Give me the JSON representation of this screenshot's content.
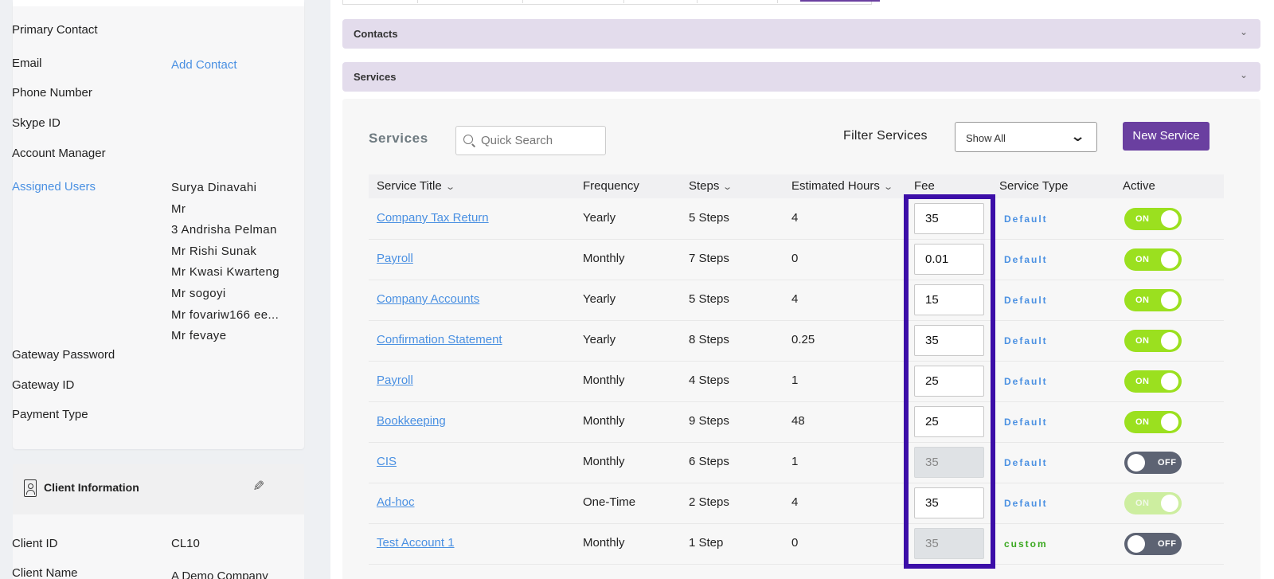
{
  "left_panel": {
    "fields": [
      {
        "label": "Primary Contact",
        "value": ""
      },
      {
        "label": "Email",
        "value": "Add Contact"
      },
      {
        "label": "Phone Number",
        "value": ""
      },
      {
        "label": "Skype ID",
        "value": ""
      },
      {
        "label": "Account Manager",
        "value": ""
      },
      {
        "label": "Assigned Users",
        "value": ""
      },
      {
        "label": "Gateway Password",
        "value": ""
      },
      {
        "label": "Gateway ID",
        "value": ""
      },
      {
        "label": "Payment Type",
        "value": ""
      }
    ],
    "assigned_users": [
      "Surya Dinavahi",
      "Mr",
      "3 Andrisha Pelman",
      "Mr Rishi Sunak",
      "Mr Kwasi Kwarteng",
      "Mr sogoyi",
      "Mr fovariw166 ee...",
      "Mr fevaye"
    ],
    "client_info": {
      "title": "Client Information",
      "client_id_label": "Client ID",
      "client_id": "CL10",
      "client_name_label": "Client Name",
      "client_name": "A Demo Company"
    }
  },
  "accordions": {
    "contacts": "Contacts",
    "services": "Services"
  },
  "services": {
    "title": "Services",
    "search_placeholder": "Quick Search",
    "filter_label": "Filter Services",
    "filter_value": "Show All",
    "new_button": "New Service",
    "columns": [
      "Service Title",
      "Frequency",
      "Steps",
      "Estimated Hours",
      "Fee",
      "Service Type",
      "Active"
    ],
    "rows": [
      {
        "title": "Company Tax Return",
        "frequency": "Yearly",
        "steps": "5 Steps",
        "hours": "4",
        "fee": "35",
        "fee_disabled": false,
        "type": "Default",
        "active": "ON",
        "faded": false
      },
      {
        "title": "Payroll",
        "frequency": "Monthly",
        "steps": "7 Steps",
        "hours": "0",
        "fee": "0.01",
        "fee_disabled": false,
        "type": "Default",
        "active": "ON",
        "faded": false
      },
      {
        "title": "Company Accounts",
        "frequency": "Yearly",
        "steps": "5 Steps",
        "hours": "4",
        "fee": "15",
        "fee_disabled": false,
        "type": "Default",
        "active": "ON",
        "faded": false
      },
      {
        "title": "Confirmation Statement",
        "frequency": "Yearly",
        "steps": "8 Steps",
        "hours": "0.25",
        "fee": "35",
        "fee_disabled": false,
        "type": "Default",
        "active": "ON",
        "faded": false
      },
      {
        "title": "Payroll",
        "frequency": "Monthly",
        "steps": "4 Steps",
        "hours": "1",
        "fee": "25",
        "fee_disabled": false,
        "type": "Default",
        "active": "ON",
        "faded": false
      },
      {
        "title": "Bookkeeping",
        "frequency": "Monthly",
        "steps": "9 Steps",
        "hours": "48",
        "fee": "25",
        "fee_disabled": false,
        "type": "Default",
        "active": "ON",
        "faded": false
      },
      {
        "title": "CIS",
        "frequency": "Monthly",
        "steps": "6 Steps",
        "hours": "1",
        "fee": "35",
        "fee_disabled": true,
        "type": "Default",
        "active": "OFF",
        "faded": false
      },
      {
        "title": "Ad-hoc",
        "frequency": "One-Time",
        "steps": "2 Steps",
        "hours": "4",
        "fee": "35",
        "fee_disabled": false,
        "type": "Default",
        "active": "ON",
        "faded": true
      },
      {
        "title": "Test Account 1",
        "frequency": "Monthly",
        "steps": "1 Step",
        "hours": "0",
        "fee": "35",
        "fee_disabled": true,
        "type": "custom",
        "active": "OFF",
        "faded": false
      }
    ]
  },
  "colors": {
    "accent": "#6a3fa0",
    "link": "#4a90e2",
    "toggle_on": "#9be01f",
    "toggle_off": "#5d6373",
    "highlight": "#3c0ea8",
    "custom_type": "#3aa81f"
  }
}
